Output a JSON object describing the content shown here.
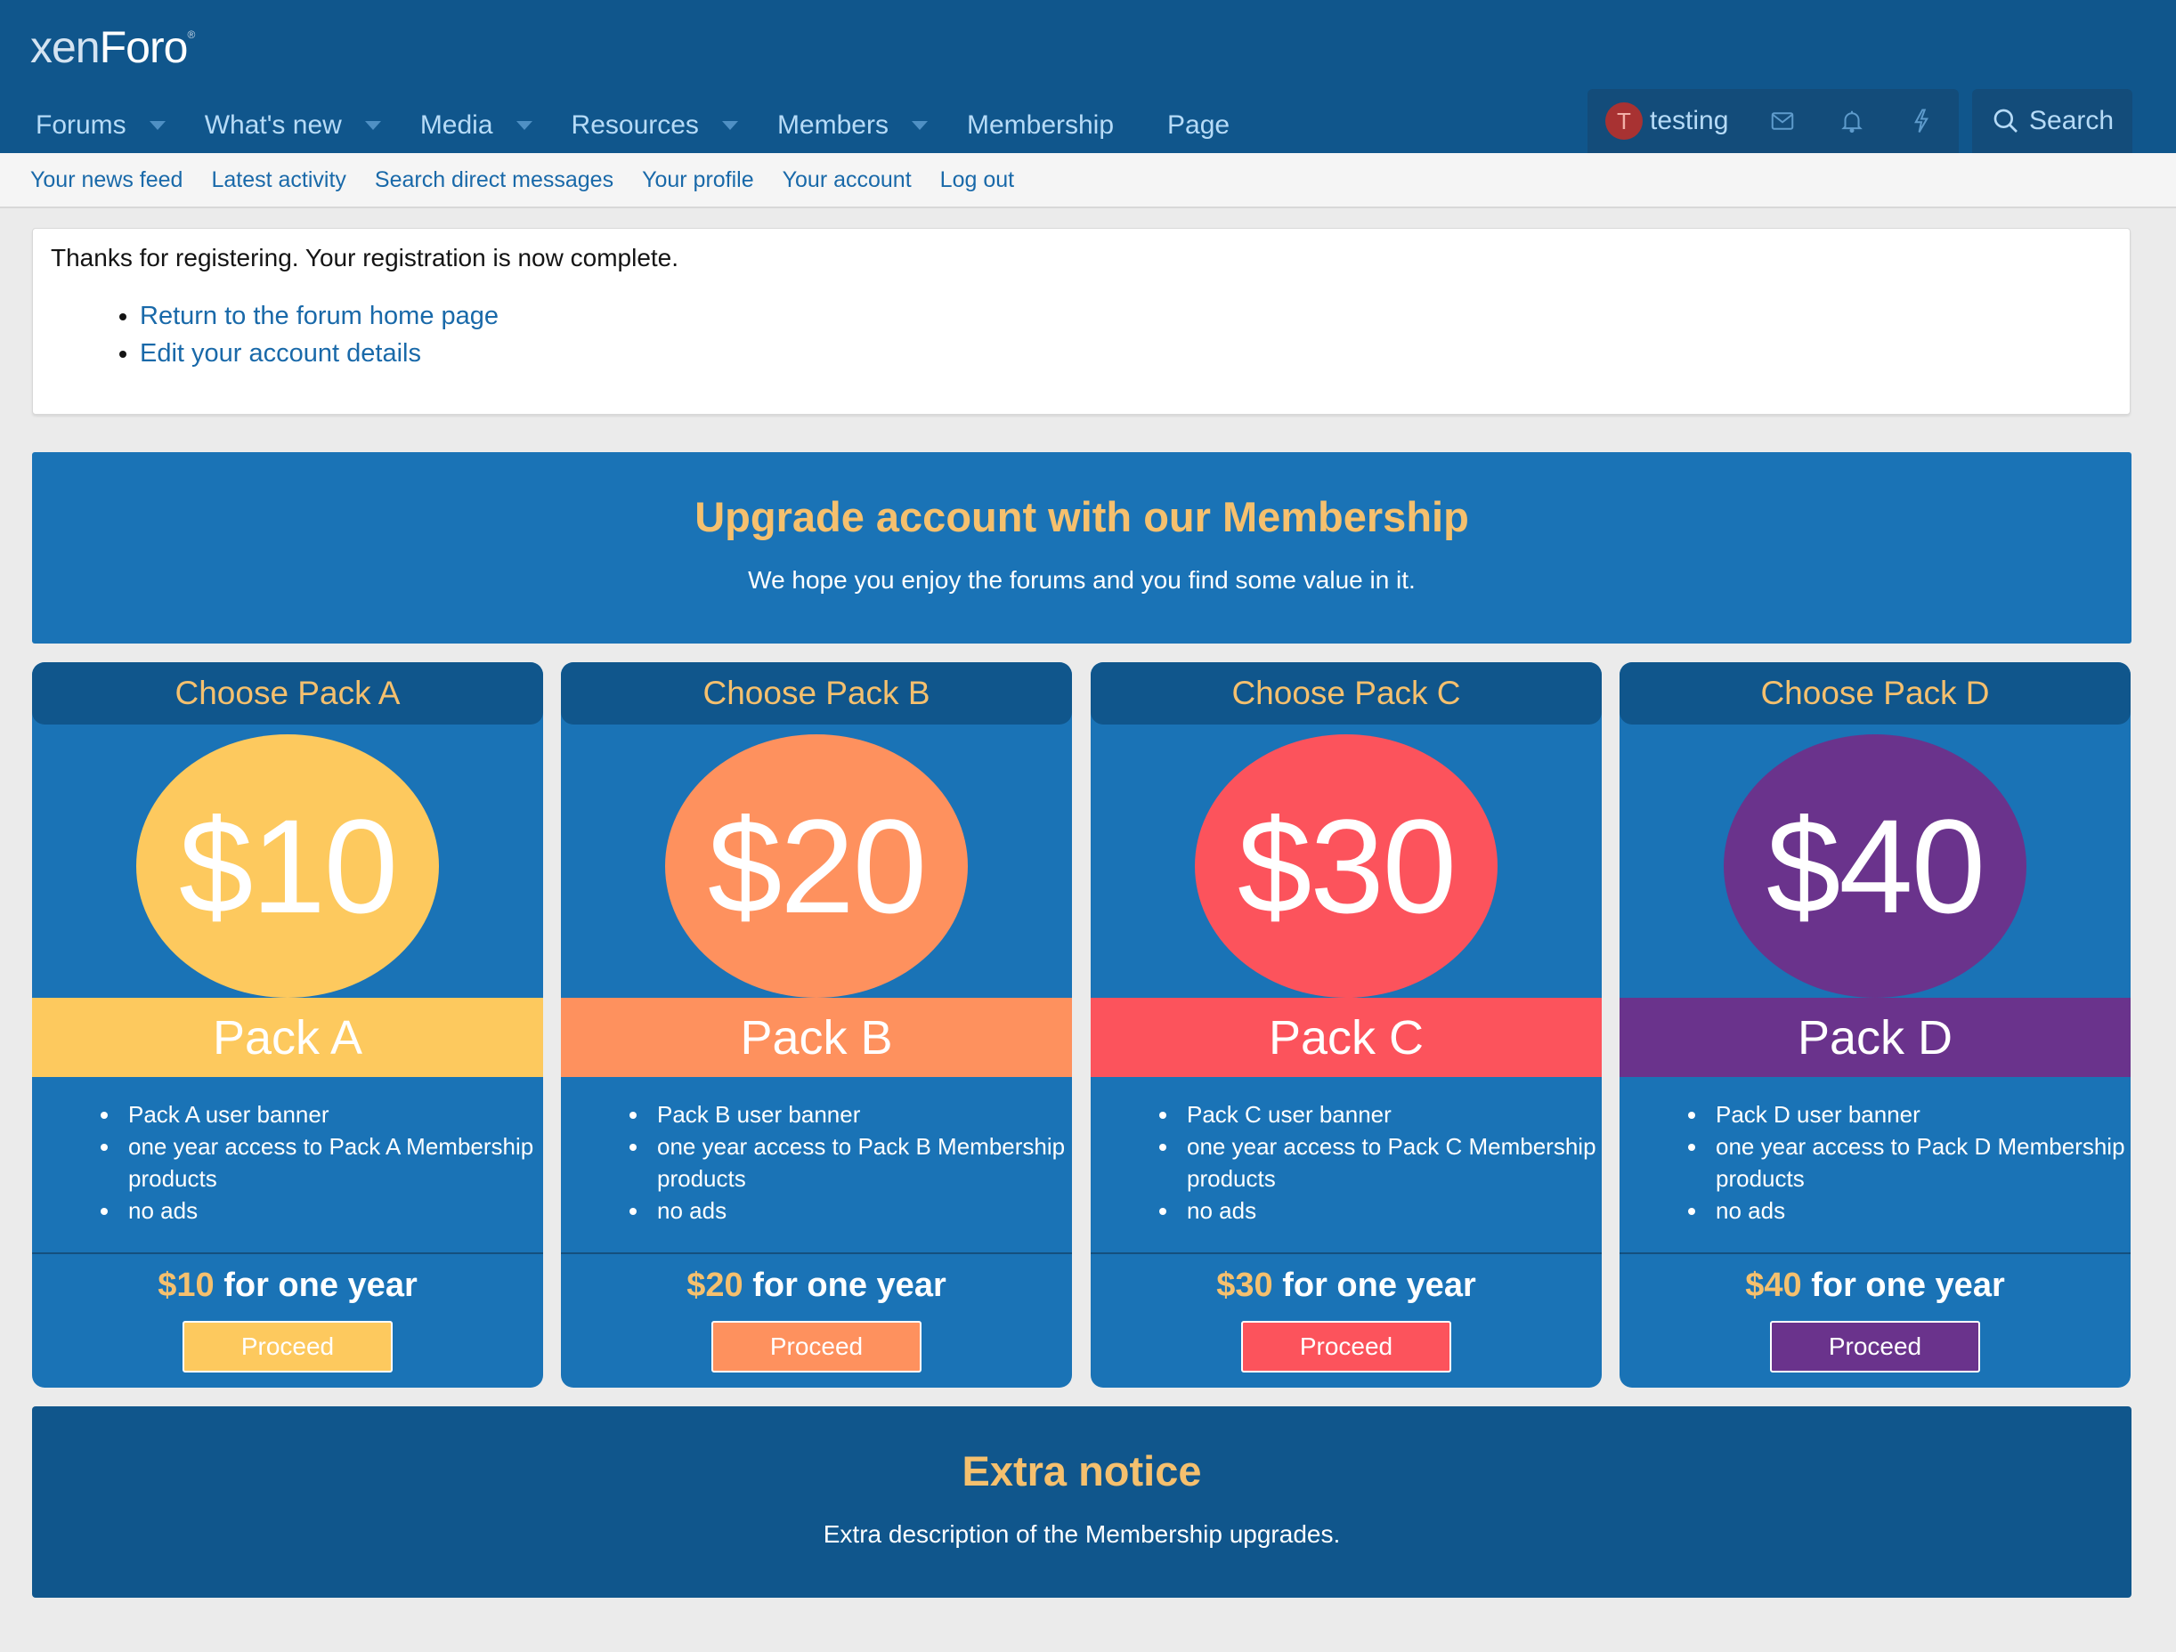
{
  "header": {
    "logo_main": "xen",
    "logo_accent": "Foro",
    "logo_reg": "®",
    "nav": [
      {
        "label": "Forums",
        "has_dropdown": true
      },
      {
        "label": "What's new",
        "has_dropdown": true
      },
      {
        "label": "Media",
        "has_dropdown": true
      },
      {
        "label": "Resources",
        "has_dropdown": true
      },
      {
        "label": "Members",
        "has_dropdown": true
      },
      {
        "label": "Membership",
        "has_dropdown": false
      },
      {
        "label": "Page",
        "has_dropdown": false
      }
    ],
    "user": {
      "avatar_letter": "T",
      "username": "testing",
      "avatar_color": "#a83232"
    },
    "icons": [
      "envelope-icon",
      "bell-icon",
      "lightning-icon"
    ],
    "search_label": "Search"
  },
  "subnav": [
    "Your news feed",
    "Latest activity",
    "Search direct messages",
    "Your profile",
    "Your account",
    "Log out"
  ],
  "message": {
    "text": "Thanks for registering. Your registration is now complete.",
    "links": [
      "Return to the forum home page",
      "Edit your account details"
    ]
  },
  "upgrade": {
    "title": "Upgrade account with our Membership",
    "description": "We hope you enjoy the forums and you find some value in it."
  },
  "packs": [
    {
      "heading": "Choose Pack A",
      "price": "$10",
      "name": "Pack A",
      "color": "#fdc95e",
      "features": [
        "Pack A user banner",
        "one year access to Pack A Membership products",
        "no ads"
      ],
      "price_amount": "$10",
      "price_suffix": "for one year",
      "button": "Proceed"
    },
    {
      "heading": "Choose Pack B",
      "price": "$20",
      "name": "Pack B",
      "color": "#fe915e",
      "features": [
        "Pack B user banner",
        "one year access to Pack B Membership products",
        "no ads"
      ],
      "price_amount": "$20",
      "price_suffix": "for one year",
      "button": "Proceed"
    },
    {
      "heading": "Choose Pack C",
      "price": "$30",
      "name": "Pack C",
      "color": "#fc535c",
      "features": [
        "Pack C user banner",
        "one year access to Pack C Membership products",
        "no ads"
      ],
      "price_amount": "$30",
      "price_suffix": "for one year",
      "button": "Proceed"
    },
    {
      "heading": "Choose Pack D",
      "price": "$40",
      "name": "Pack D",
      "color": "#6a338c",
      "features": [
        "Pack D user banner",
        "one year access to Pack D Membership products",
        "no ads"
      ],
      "price_amount": "$40",
      "price_suffix": "for one year",
      "button": "Proceed"
    }
  ],
  "extra": {
    "title": "Extra notice",
    "description": "Extra description of the Membership upgrades."
  }
}
